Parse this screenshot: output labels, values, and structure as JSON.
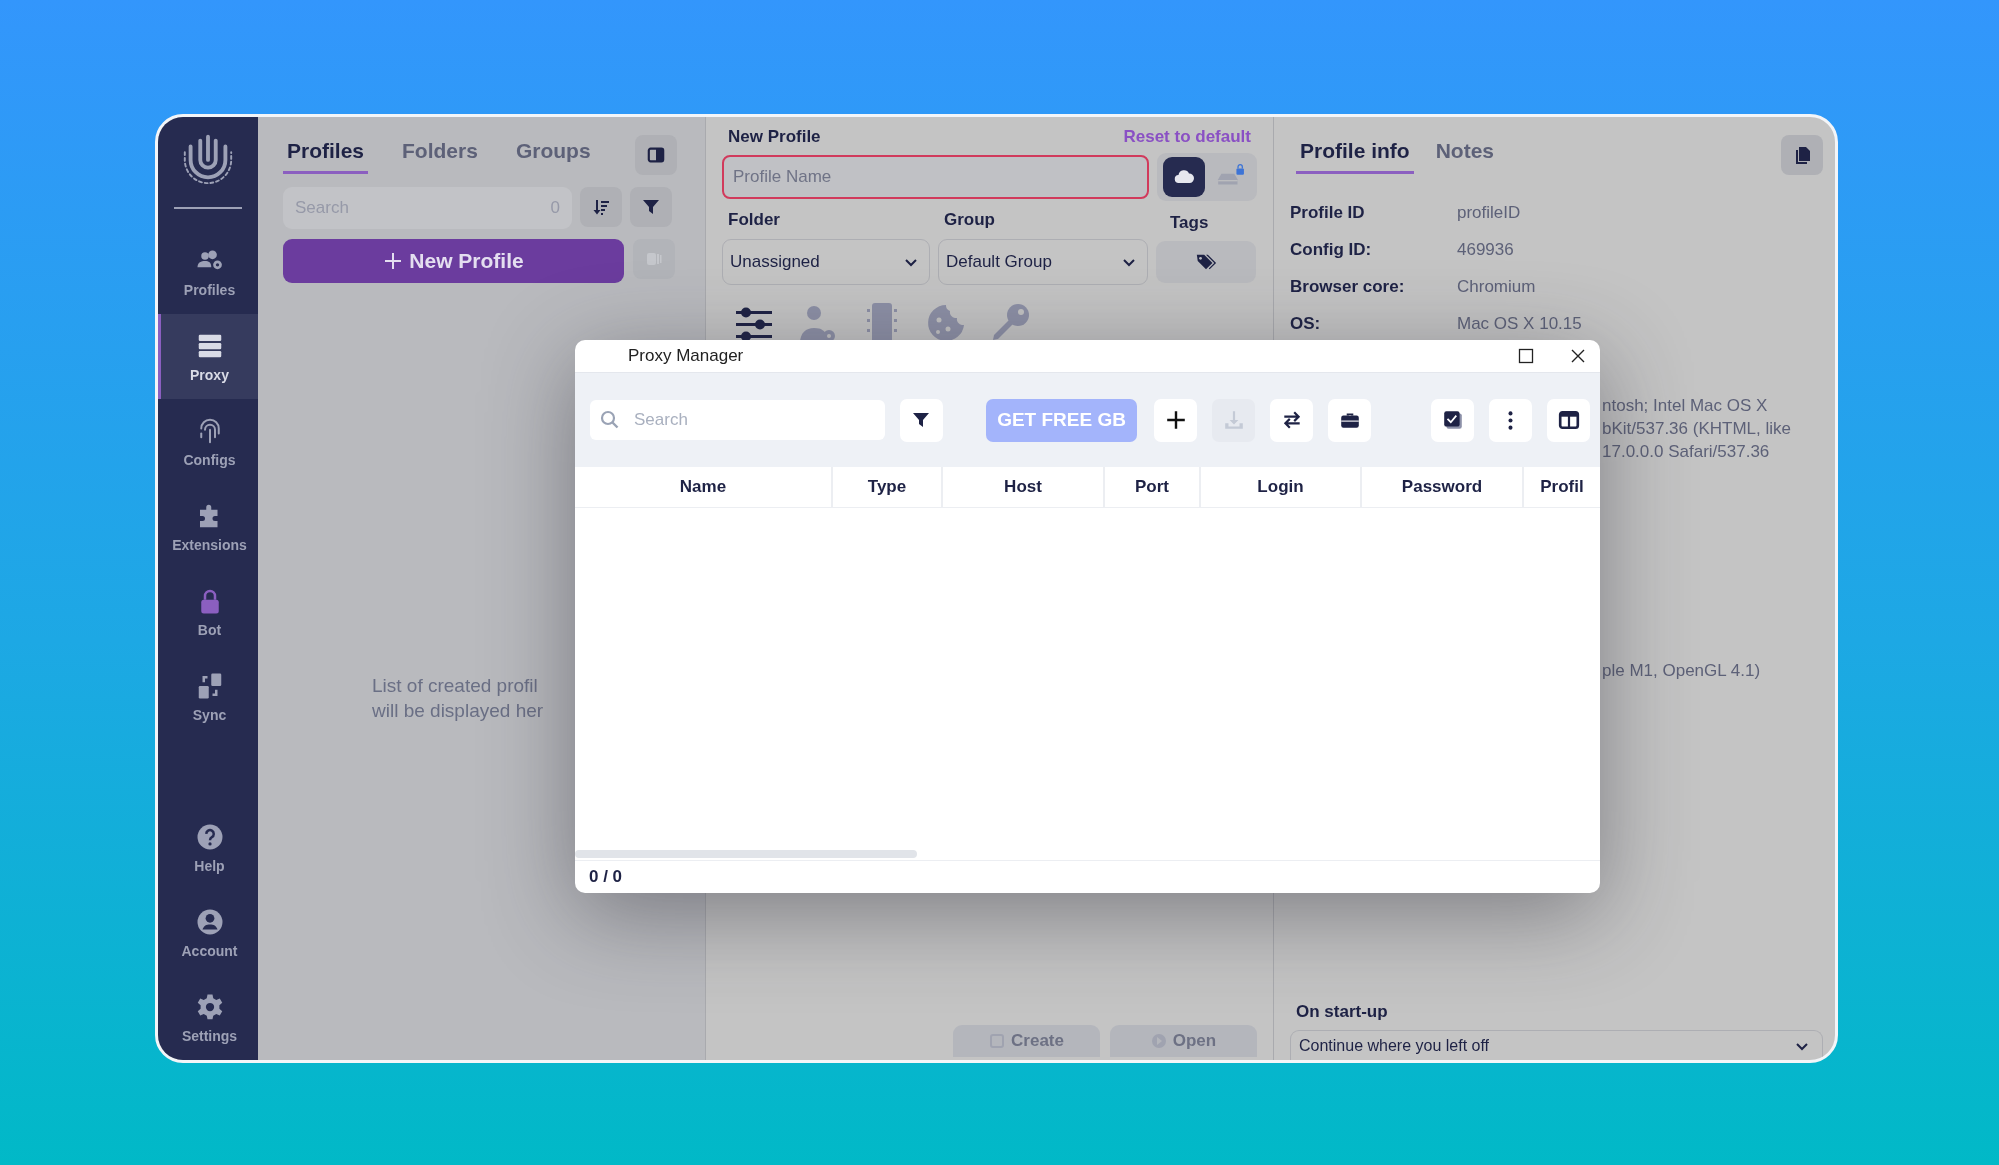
{
  "sidebar": {
    "items": [
      {
        "kind": "profiles",
        "label": "Profiles",
        "selected": false
      },
      {
        "kind": "proxy",
        "label": "Proxy",
        "selected": true
      },
      {
        "kind": "configs",
        "label": "Configs",
        "selected": false
      },
      {
        "kind": "extensions",
        "label": "Extensions",
        "selected": false
      },
      {
        "kind": "bot",
        "label": "Bot",
        "selected": false
      },
      {
        "kind": "sync",
        "label": "Sync",
        "selected": false
      },
      {
        "kind": "help",
        "label": "Help",
        "selected": false
      },
      {
        "kind": "account",
        "label": "Account",
        "selected": false
      },
      {
        "kind": "settings",
        "label": "Settings",
        "selected": false
      }
    ]
  },
  "profiles_panel": {
    "tabs": [
      {
        "label": "Profiles",
        "selected": true
      },
      {
        "label": "Folders",
        "selected": false
      },
      {
        "label": "Groups",
        "selected": false
      }
    ],
    "search": {
      "placeholder": "Search",
      "count": "0"
    },
    "new_profile_button": "New Profile",
    "empty_message": [
      "List of created profil",
      "will be displayed her"
    ]
  },
  "new_profile": {
    "title": "New Profile",
    "reset_link": "Reset to default",
    "name_field": {
      "placeholder": "Profile Name",
      "invalid": true
    },
    "storage_options": [
      {
        "kind": "cloud",
        "selected": true
      },
      {
        "kind": "local",
        "selected": false
      }
    ],
    "folder": {
      "label": "Folder",
      "value": "Unassigned"
    },
    "group": {
      "label": "Group",
      "value": "Default Group"
    },
    "tags": {
      "label": "Tags"
    },
    "buttons": [
      "Create",
      "Open"
    ]
  },
  "profile_info": {
    "tabs": [
      {
        "label": "Profile info",
        "selected": true
      },
      {
        "label": "Notes",
        "selected": false
      }
    ],
    "fields": [
      {
        "label": "Profile ID",
        "value": "profileID"
      },
      {
        "label": "Config ID:",
        "value": "469936"
      },
      {
        "label": "Browser core:",
        "value": "Chromium"
      },
      {
        "label": "OS:",
        "value": "Mac OS X 10.15"
      }
    ],
    "user_agent_fragments": [
      "ntosh; Intel Mac OS X",
      "bKit/537.36 (KHTML, like",
      "17.0.0.0 Safari/537.36"
    ],
    "webgl_fragment": "ple M1, OpenGL 4.1)",
    "startup": {
      "label": "On start-up",
      "value": "Continue where you left off"
    }
  },
  "proxy_manager": {
    "title": "Proxy Manager",
    "search": {
      "placeholder": "Search"
    },
    "promo_button": "GET FREE GB",
    "toolbar": [
      {
        "kind": "add",
        "disabled": false
      },
      {
        "kind": "download",
        "disabled": true
      },
      {
        "kind": "swap",
        "disabled": false
      },
      {
        "kind": "briefcase",
        "disabled": false
      }
    ],
    "toolbar_right": [
      {
        "kind": "check"
      },
      {
        "kind": "more"
      },
      {
        "kind": "columns"
      }
    ],
    "columns": [
      "Name",
      "Type",
      "Host",
      "Port",
      "Login",
      "Password",
      "Profil"
    ],
    "counter": "0 / 0"
  }
}
